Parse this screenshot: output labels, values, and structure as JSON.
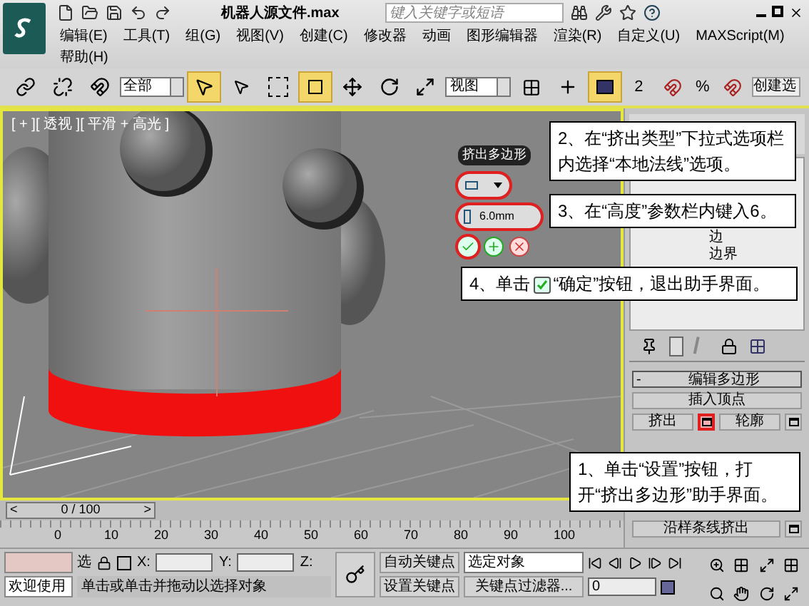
{
  "title_bar": {
    "file_title": "机器人源文件.max",
    "search": {
      "placeholder": "键入关键字或短语"
    }
  },
  "menu": [
    "编辑(E)",
    "工具(T)",
    "组(G)",
    "视图(V)",
    "创建(C)",
    "修改器",
    "动画",
    "图形编辑器",
    "渲染(R)",
    "自定义(U)",
    "MAXScript(M)",
    "帮助(H)"
  ],
  "toolbar": {
    "selection_filter": "全部",
    "reference_coord": "视图",
    "angle_snap": "2",
    "percent_snap": "%",
    "named_selection": "创建选"
  },
  "viewport": {
    "label": "[ + ][ 透视 ][ 平滑 + 高光 ]"
  },
  "caddy": {
    "title": "挤出多边形",
    "height_value": "6.0mm",
    "type_highlighted": true,
    "height_highlighted": true,
    "ok_highlighted": true
  },
  "command_panel": {
    "tree_items": [
      "边",
      "边界"
    ],
    "rollout": {
      "collapse": "-",
      "title": "编辑多边形",
      "rows": [
        [
          {
            "label": "插入顶点",
            "settings": false
          }
        ],
        [
          {
            "label": "挤出",
            "settings": true,
            "highlighted": true
          },
          {
            "label": "轮廓",
            "settings": true,
            "highlighted": false
          }
        ],
        [
          {
            "label": "沿样条线挤出",
            "settings": true,
            "highlighted": false
          }
        ]
      ]
    }
  },
  "callouts": [
    {
      "text": "2、在“挤出类型”下拉式选项栏内选择“本地法线”选项。"
    },
    {
      "text": "3、在“高度”参数栏内键入6。"
    },
    {
      "text": "4、单击",
      "after": "“确定”按钮，退出助手界面。"
    },
    {
      "text": "1、单击“设置”按钮，打开“挤出多边形”助手界面。"
    }
  ],
  "time_slider": {
    "level": 0,
    "prev": "<",
    "position": "0 / 100",
    "next": ">"
  },
  "ruler": {
    "ticks": [
      "0",
      "10",
      "20",
      "30",
      "40",
      "50",
      "60",
      "70",
      "80",
      "90",
      "100"
    ]
  },
  "status": {
    "welcome": "欢迎使用",
    "selection_lock": "选",
    "x_label": "X:",
    "y_label": "Y:",
    "z_label": "Z:",
    "prompt": "单击或单击并拖动以选择对象",
    "auto_key": "自动关键点",
    "set_key": "设置关键点",
    "key_mode": "选定对象",
    "key_filters": "关键点过滤器...",
    "frame": "0"
  }
}
